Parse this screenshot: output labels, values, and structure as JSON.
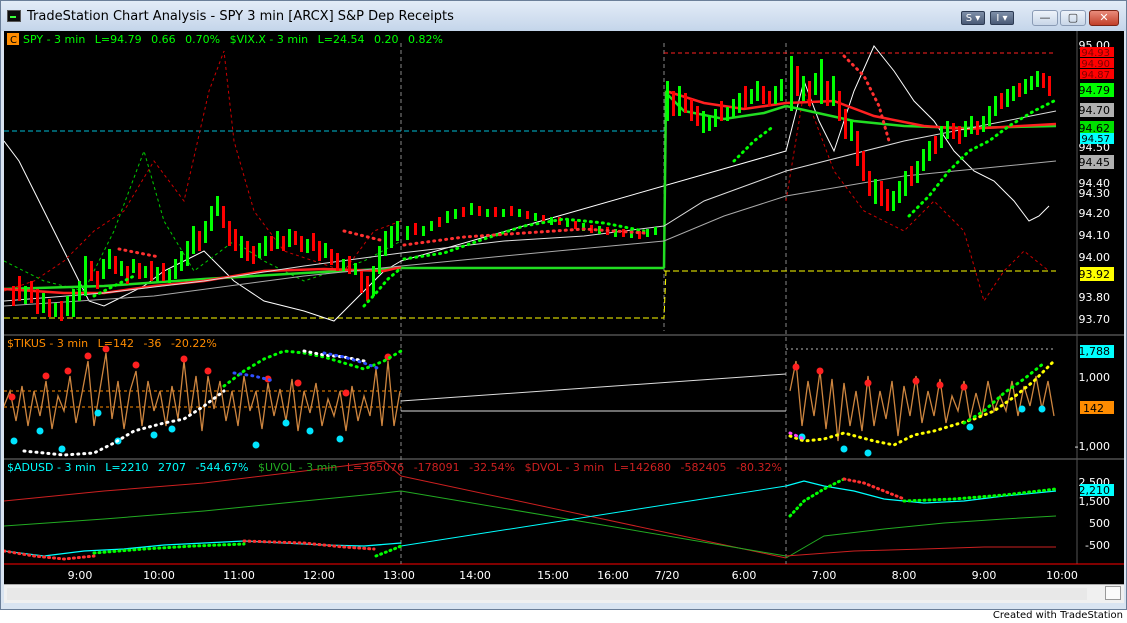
{
  "window": {
    "title": "TradeStation Chart Analysis - SPY  3 min  [ARCX] S&P Dep Receipts",
    "btn_s": "S ▾",
    "btn_i": "I ▾",
    "btn_min": "—",
    "btn_max": "▢",
    "btn_close": "✕"
  },
  "panes": {
    "p1": {
      "badge": "C",
      "symbol": "SPY - 3 min",
      "last": "L=94.79",
      "chg": "0.66",
      "pct": "0.70%",
      "symbol2": "$VIX.X - 3 min",
      "last2": "L=24.54",
      "chg2": "0.20",
      "pct2": "0.82%"
    },
    "p2": {
      "symbol": "$TIKUS - 3 min",
      "last": "L=142",
      "chg": "-36",
      "pct": "-20.22%"
    },
    "p3": {
      "symbol": "$ADUSD - 3 min",
      "last": "L=2210",
      "chg": "2707",
      "pct": "-544.67%",
      "symbol2": "$UVOL - 3 min",
      "last2": "L=365076",
      "chg2": "-178091",
      "pct2": "-32.54%",
      "symbol3": "$DVOL - 3 min",
      "last3": "L=142680",
      "chg3": "-582405",
      "pct3": "-80.32%"
    }
  },
  "price_axis": {
    "ticks": [
      "95.00",
      "94.90",
      "94.80",
      "94.70",
      "94.60",
      "94.50",
      "94.40",
      "94.30",
      "94.20",
      "94.10",
      "94.00",
      "93.90",
      "93.80",
      "93.70"
    ],
    "badges": [
      {
        "text": "94.93",
        "bg": "#ff0000",
        "fg": "#800000"
      },
      {
        "text": "94.90",
        "bg": "#ff0000",
        "fg": "#800000"
      },
      {
        "text": "94.87",
        "bg": "#ff0000",
        "fg": "#800000"
      },
      {
        "text": "94.79",
        "bg": "#00ff00",
        "fg": "#000000"
      },
      {
        "text": "94.70",
        "bg": "#b0b0b0",
        "fg": "#000000"
      },
      {
        "text": "94.62",
        "bg": "#00e000",
        "fg": "#000000"
      },
      {
        "text": "94.57",
        "bg": "#00ffff",
        "fg": "#000000"
      },
      {
        "text": "94.45",
        "bg": "#b0b0b0",
        "fg": "#000000"
      },
      {
        "text": "93.92",
        "bg": "#ffff00",
        "fg": "#000000"
      }
    ]
  },
  "tick_axis": {
    "ticks": [
      "1,000",
      "-1,000"
    ],
    "badges": [
      {
        "text": "1,788",
        "bg": "#00ffff",
        "fg": "#000000"
      },
      {
        "text": "142",
        "bg": "#ff8c00",
        "fg": "#000000"
      }
    ]
  },
  "ad_axis": {
    "ticks": [
      "2,500",
      "1,500",
      "500",
      "-500"
    ],
    "badges": [
      {
        "text": "2,210",
        "bg": "#00ffff",
        "fg": "#000000"
      }
    ]
  },
  "time_axis": [
    "9:00",
    "10:00",
    "11:00",
    "12:00",
    "13:00",
    "14:00",
    "15:00",
    "16:00",
    "7/20",
    "6:00",
    "7:00",
    "8:00",
    "9:00",
    "10:00"
  ],
  "footer": "Created with TradeStation",
  "colors": {
    "background": "#000000",
    "up": "#00ff00",
    "down": "#ff0000",
    "vix": "#ffffff",
    "tick": "#cd853f",
    "adv": "#00ffff",
    "uvol": "#00ff00",
    "dvol": "#ff0000"
  }
}
